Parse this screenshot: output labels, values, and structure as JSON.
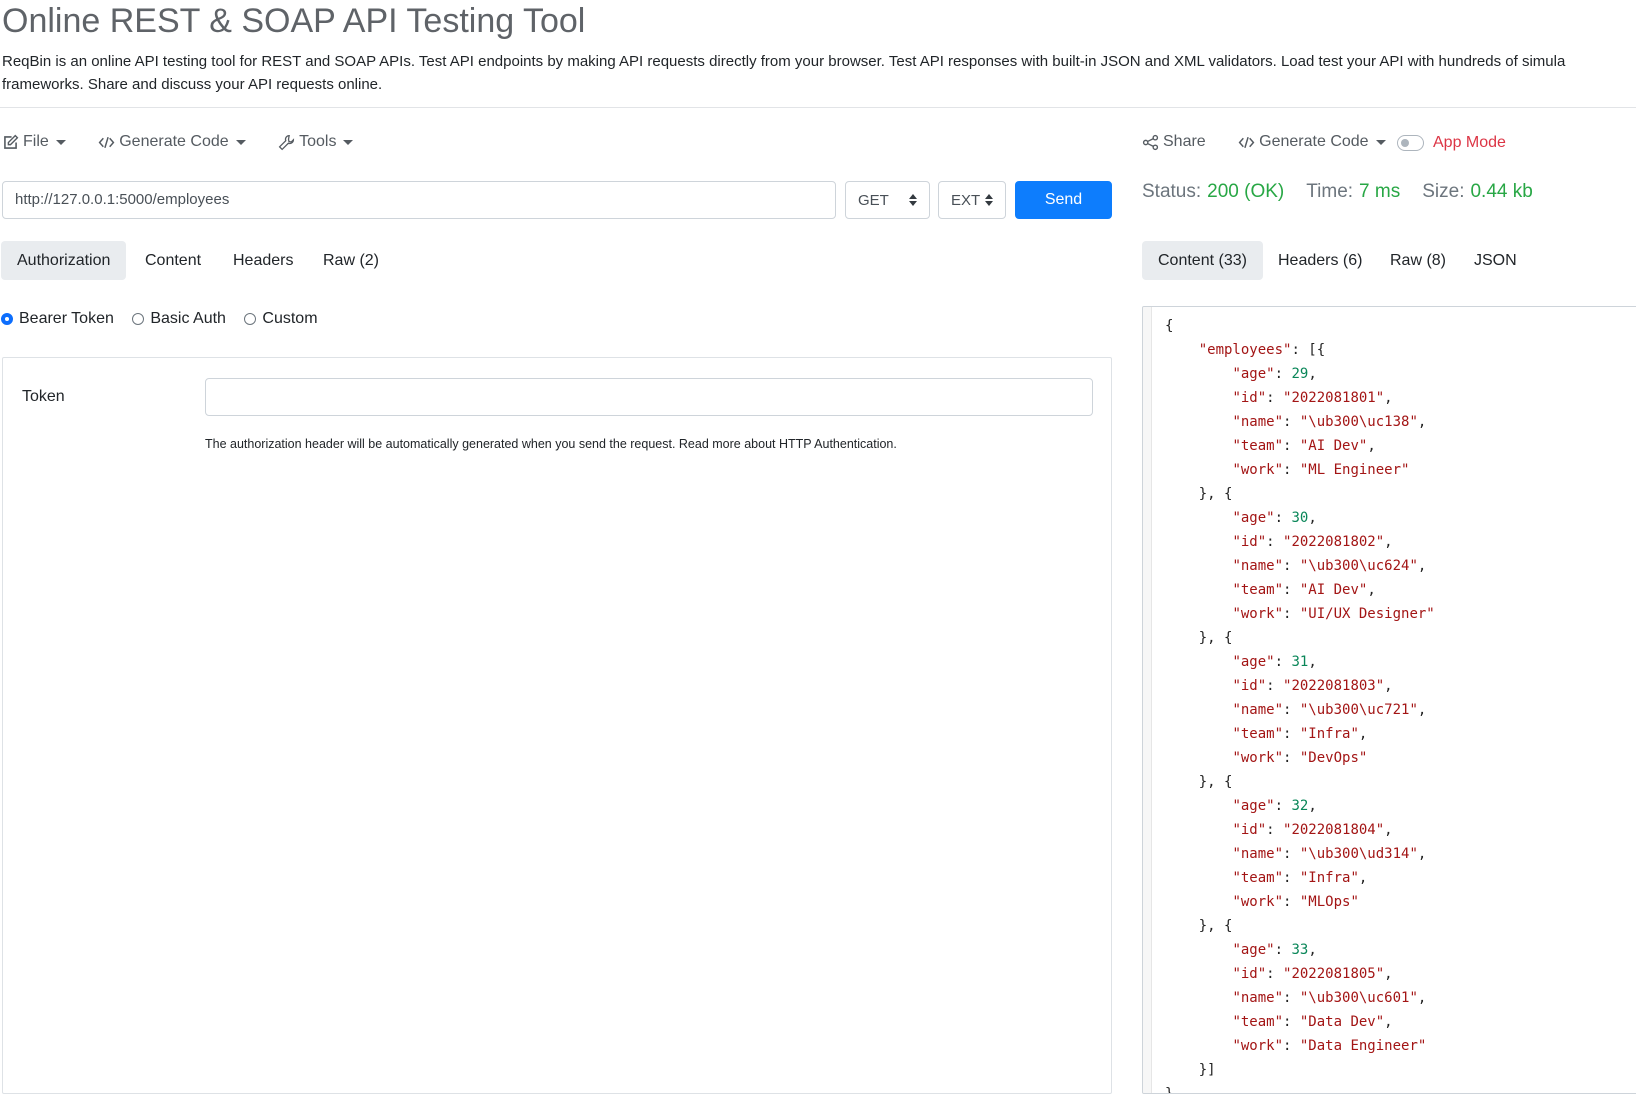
{
  "page": {
    "title": "Online REST & SOAP API Testing Tool",
    "description_line1": "ReqBin is an online API testing tool for REST and SOAP APIs. Test API endpoints by making API requests directly from your browser. Test API responses with built-in JSON and XML validators. Load test your API with hundreds of simula",
    "description_line2": "frameworks. Share and discuss your API requests online."
  },
  "request_toolbar": {
    "file_label": "File",
    "generate_code_label": "Generate Code",
    "tools_label": "Tools"
  },
  "request": {
    "url": "http://127.0.0.1:5000/employees",
    "method": "GET",
    "ext": "EXT",
    "send_label": "Send"
  },
  "request_tabs": [
    {
      "label": "Authorization",
      "active": true
    },
    {
      "label": "Content",
      "active": false
    },
    {
      "label": "Headers",
      "active": false
    },
    {
      "label": "Raw (2)",
      "active": false
    }
  ],
  "auth": {
    "options": [
      {
        "label": "Bearer Token",
        "selected": true
      },
      {
        "label": "Basic Auth",
        "selected": false
      },
      {
        "label": "Custom",
        "selected": false
      }
    ],
    "token_label": "Token",
    "token_value": "",
    "help_text": "The authorization header will be automatically generated when you send the request. Read more about HTTP Authentication."
  },
  "response_toolbar": {
    "share_label": "Share",
    "generate_code_label": "Generate Code",
    "app_mode_label": "App Mode",
    "app_mode_on": false
  },
  "response_status": {
    "status_key": "Status:",
    "status_value": "200 (OK)",
    "time_key": "Time:",
    "time_value": "7 ms",
    "size_key": "Size:",
    "size_value": "0.44 kb"
  },
  "response_tabs": [
    {
      "label": "Content (33)",
      "active": true
    },
    {
      "label": "Headers (6)",
      "active": false
    },
    {
      "label": "Raw (8)",
      "active": false
    },
    {
      "label": "JSON",
      "active": false
    }
  ],
  "response_body": {
    "root_key": "employees",
    "employees": [
      {
        "age": "29",
        "id": "\"2022081801\"",
        "name": "\"\\ub300\\uc138\"",
        "team": "\"AI Dev\"",
        "work": "\"ML Engineer\""
      },
      {
        "age": "30",
        "id": "\"2022081802\"",
        "name": "\"\\ub300\\uc624\"",
        "team": "\"AI Dev\"",
        "work": "\"UI/UX Designer\""
      },
      {
        "age": "31",
        "id": "\"2022081803\"",
        "name": "\"\\ub300\\uc721\"",
        "team": "\"Infra\"",
        "work": "\"DevOps\""
      },
      {
        "age": "32",
        "id": "\"2022081804\"",
        "name": "\"\\ub300\\ud314\"",
        "team": "\"Infra\"",
        "work": "\"MLOps\""
      },
      {
        "age": "33",
        "id": "\"2022081805\"",
        "name": "\"\\ub300\\uc601\"",
        "team": "\"Data Dev\"",
        "work": "\"Data Engineer\""
      }
    ]
  },
  "colors": {
    "accent": "#0d7dfd",
    "status_ok": "#28a745",
    "app_mode": "#dc3545"
  }
}
